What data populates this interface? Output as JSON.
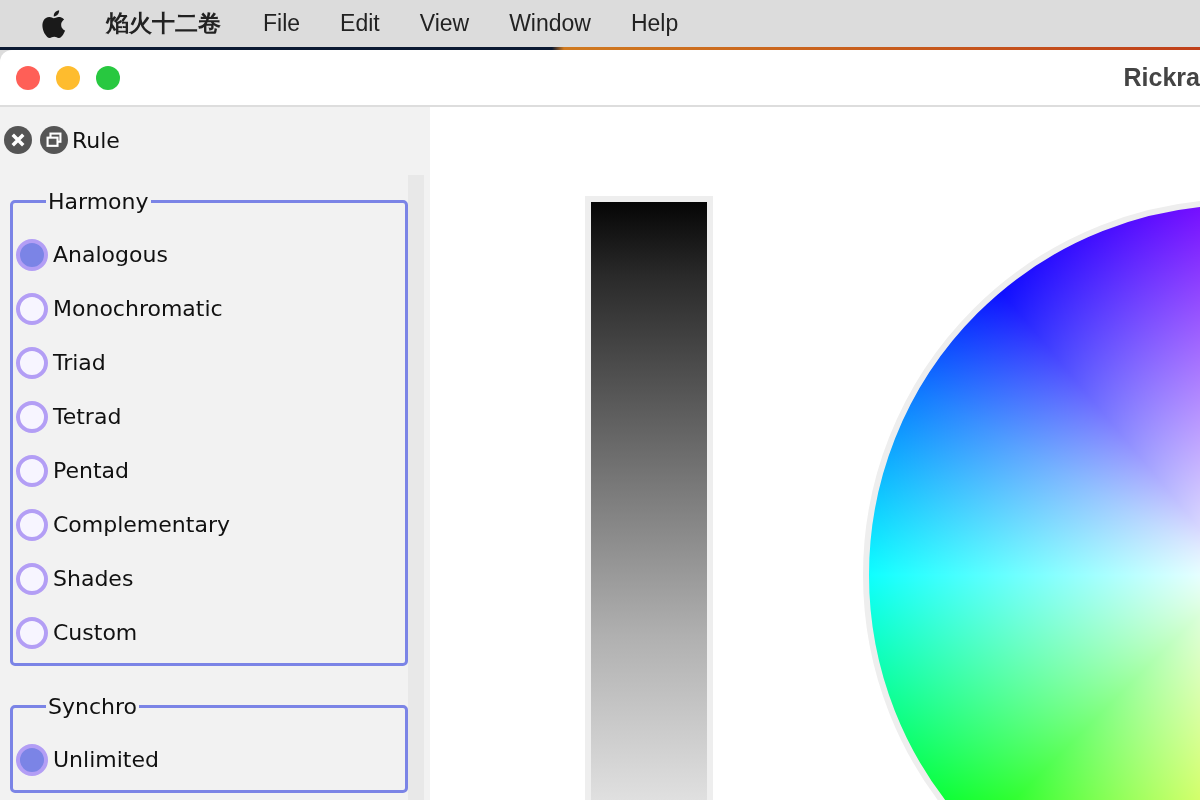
{
  "menu_bar": {
    "app_name": "焰火十二卷",
    "items": [
      "File",
      "Edit",
      "View",
      "Window",
      "Help"
    ]
  },
  "window": {
    "title": "Rickra"
  },
  "panel": {
    "title": "Rule"
  },
  "groups": [
    {
      "title": "Harmony",
      "options": [
        {
          "label": "Analogous",
          "selected": true
        },
        {
          "label": "Monochromatic",
          "selected": false
        },
        {
          "label": "Triad",
          "selected": false
        },
        {
          "label": "Tetrad",
          "selected": false
        },
        {
          "label": "Pentad",
          "selected": false
        },
        {
          "label": "Complementary",
          "selected": false
        },
        {
          "label": "Shades",
          "selected": false
        },
        {
          "label": "Custom",
          "selected": false
        }
      ]
    },
    {
      "title": "Synchro",
      "options": [
        {
          "label": "Unlimited",
          "selected": true
        }
      ]
    }
  ]
}
